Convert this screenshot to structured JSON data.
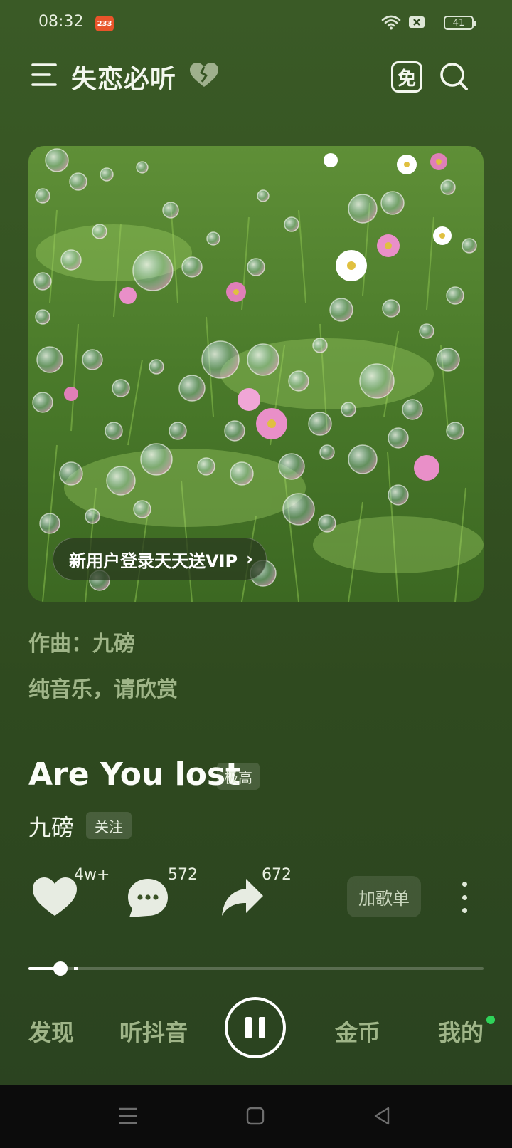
{
  "status_bar": {
    "time": "08:32",
    "badge": "233",
    "battery": "41"
  },
  "header": {
    "title": "失恋必听",
    "free_label": "免"
  },
  "cover": {
    "vip_banner": "新用户登录天天送VIP"
  },
  "info": {
    "composer": "作曲：九磅",
    "note": "纯音乐，请欣赏"
  },
  "song": {
    "title": "Are You lost",
    "quality": "极高",
    "artist": "九磅",
    "follow_label": "关注"
  },
  "actions": {
    "like_count": "4w+",
    "comment_count": "572",
    "share_count": "672",
    "add_playlist": "加歌单"
  },
  "progress": {
    "played_fraction": 0.07
  },
  "tabs": {
    "discover": "发现",
    "douyin": "听抖音",
    "coins": "金币",
    "mine": "我的"
  },
  "colors": {
    "accent_green": "#2fd35a",
    "muted_text": "#9fb588"
  }
}
